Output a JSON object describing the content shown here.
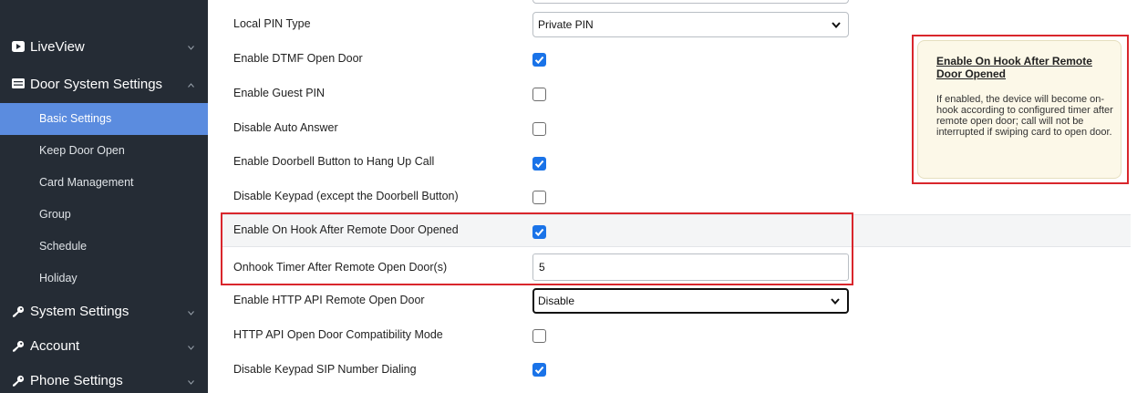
{
  "sidebar": {
    "items": [
      {
        "label": "LiveView",
        "icon": "video-icon",
        "type": "main",
        "chevron": "down"
      },
      {
        "label": "Door System Settings",
        "icon": "list-icon",
        "type": "main",
        "chevron": "up"
      },
      {
        "label": "Basic Settings",
        "type": "sub",
        "active": true
      },
      {
        "label": "Keep Door Open",
        "type": "sub"
      },
      {
        "label": "Card Management",
        "type": "sub"
      },
      {
        "label": "Group",
        "type": "sub"
      },
      {
        "label": "Schedule",
        "type": "sub"
      },
      {
        "label": "Holiday",
        "type": "sub"
      },
      {
        "label": "System Settings",
        "icon": "key-icon",
        "type": "main",
        "chevron": "down"
      },
      {
        "label": "Account",
        "icon": "key-icon",
        "type": "main",
        "chevron": "down"
      },
      {
        "label": "Phone Settings",
        "icon": "key-icon",
        "type": "main",
        "chevron": "down"
      }
    ]
  },
  "form": {
    "rows": [
      {
        "label": "Local PIN Type",
        "control": "select",
        "value": "Private PIN"
      },
      {
        "label": "Enable DTMF Open Door",
        "control": "checkbox",
        "checked": true
      },
      {
        "label": "Enable Guest PIN",
        "control": "checkbox",
        "checked": false
      },
      {
        "label": "Disable Auto Answer",
        "control": "checkbox",
        "checked": false
      },
      {
        "label": "Enable Doorbell Button to Hang Up Call",
        "control": "checkbox",
        "checked": true
      },
      {
        "label": "Disable Keypad (except the Doorbell Button)",
        "control": "checkbox",
        "checked": false
      },
      {
        "label": "Enable On Hook After Remote Door Opened",
        "control": "checkbox",
        "checked": true,
        "highlighted": true
      },
      {
        "label": "Onhook Timer After Remote Open Door(s)",
        "control": "text",
        "value": "5"
      },
      {
        "label": "Enable HTTP API Remote Open Door",
        "control": "select",
        "value": "Disable",
        "focused": true
      },
      {
        "label": "HTTP API Open Door Compatibility Mode",
        "control": "checkbox",
        "checked": false
      },
      {
        "label": "Disable Keypad SIP Number Dialing",
        "control": "checkbox",
        "checked": true
      }
    ]
  },
  "tooltip": {
    "title": "Enable On Hook After Remote Door Opened",
    "body": "If enabled, the device will become on-hook according to configured timer after remote open door; call will not be interrupted if swiping card to open door."
  },
  "colors": {
    "sidebar_bg": "#252c35",
    "active_item": "#5b8cdf",
    "checkbox_checked": "#1a73e8",
    "annotation_red": "#d9262c",
    "tooltip_bg": "#fcf8e8"
  }
}
